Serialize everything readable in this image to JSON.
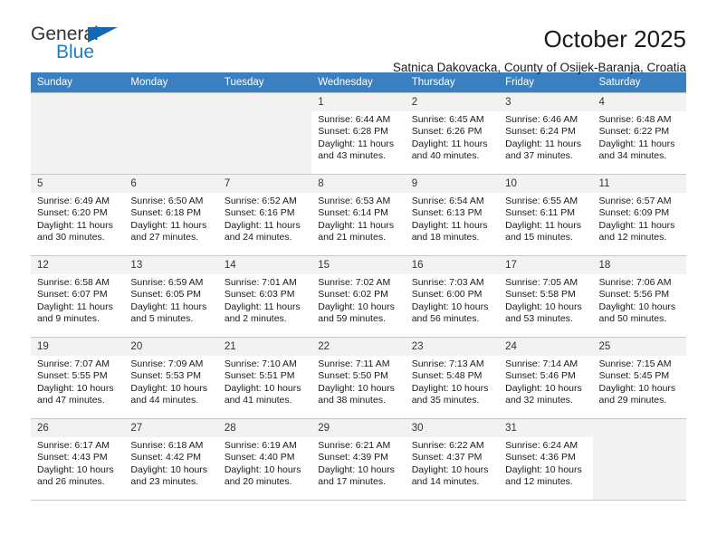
{
  "brand": {
    "line1": "General",
    "line2": "Blue",
    "flag_icon": "triangle-flag-icon",
    "color_primary": "#1268b3",
    "color_secondary": "#1f7fc4"
  },
  "header": {
    "month_title": "October 2025",
    "subtitle": "Satnica Dakovacka, County of Osijek-Baranja, Croatia"
  },
  "calendar": {
    "header_background": "#3a80c1",
    "weekday_headers": [
      "Sunday",
      "Monday",
      "Tuesday",
      "Wednesday",
      "Thursday",
      "Friday",
      "Saturday"
    ],
    "labels": {
      "sunrise": "Sunrise:",
      "sunset": "Sunset:",
      "daylight": "Daylight:"
    },
    "weeks": [
      [
        {
          "day": "",
          "empty": true
        },
        {
          "day": "",
          "empty": true
        },
        {
          "day": "",
          "empty": true
        },
        {
          "day": "1",
          "sunrise": "Sunrise: 6:44 AM",
          "sunset": "Sunset: 6:28 PM",
          "daylight_line1": "Daylight: 11 hours",
          "daylight_line2": "and 43 minutes."
        },
        {
          "day": "2",
          "sunrise": "Sunrise: 6:45 AM",
          "sunset": "Sunset: 6:26 PM",
          "daylight_line1": "Daylight: 11 hours",
          "daylight_line2": "and 40 minutes."
        },
        {
          "day": "3",
          "sunrise": "Sunrise: 6:46 AM",
          "sunset": "Sunset: 6:24 PM",
          "daylight_line1": "Daylight: 11 hours",
          "daylight_line2": "and 37 minutes."
        },
        {
          "day": "4",
          "sunrise": "Sunrise: 6:48 AM",
          "sunset": "Sunset: 6:22 PM",
          "daylight_line1": "Daylight: 11 hours",
          "daylight_line2": "and 34 minutes."
        }
      ],
      [
        {
          "day": "5",
          "sunrise": "Sunrise: 6:49 AM",
          "sunset": "Sunset: 6:20 PM",
          "daylight_line1": "Daylight: 11 hours",
          "daylight_line2": "and 30 minutes."
        },
        {
          "day": "6",
          "sunrise": "Sunrise: 6:50 AM",
          "sunset": "Sunset: 6:18 PM",
          "daylight_line1": "Daylight: 11 hours",
          "daylight_line2": "and 27 minutes."
        },
        {
          "day": "7",
          "sunrise": "Sunrise: 6:52 AM",
          "sunset": "Sunset: 6:16 PM",
          "daylight_line1": "Daylight: 11 hours",
          "daylight_line2": "and 24 minutes."
        },
        {
          "day": "8",
          "sunrise": "Sunrise: 6:53 AM",
          "sunset": "Sunset: 6:14 PM",
          "daylight_line1": "Daylight: 11 hours",
          "daylight_line2": "and 21 minutes."
        },
        {
          "day": "9",
          "sunrise": "Sunrise: 6:54 AM",
          "sunset": "Sunset: 6:13 PM",
          "daylight_line1": "Daylight: 11 hours",
          "daylight_line2": "and 18 minutes."
        },
        {
          "day": "10",
          "sunrise": "Sunrise: 6:55 AM",
          "sunset": "Sunset: 6:11 PM",
          "daylight_line1": "Daylight: 11 hours",
          "daylight_line2": "and 15 minutes."
        },
        {
          "day": "11",
          "sunrise": "Sunrise: 6:57 AM",
          "sunset": "Sunset: 6:09 PM",
          "daylight_line1": "Daylight: 11 hours",
          "daylight_line2": "and 12 minutes."
        }
      ],
      [
        {
          "day": "12",
          "sunrise": "Sunrise: 6:58 AM",
          "sunset": "Sunset: 6:07 PM",
          "daylight_line1": "Daylight: 11 hours",
          "daylight_line2": "and 9 minutes."
        },
        {
          "day": "13",
          "sunrise": "Sunrise: 6:59 AM",
          "sunset": "Sunset: 6:05 PM",
          "daylight_line1": "Daylight: 11 hours",
          "daylight_line2": "and 5 minutes."
        },
        {
          "day": "14",
          "sunrise": "Sunrise: 7:01 AM",
          "sunset": "Sunset: 6:03 PM",
          "daylight_line1": "Daylight: 11 hours",
          "daylight_line2": "and 2 minutes."
        },
        {
          "day": "15",
          "sunrise": "Sunrise: 7:02 AM",
          "sunset": "Sunset: 6:02 PM",
          "daylight_line1": "Daylight: 10 hours",
          "daylight_line2": "and 59 minutes."
        },
        {
          "day": "16",
          "sunrise": "Sunrise: 7:03 AM",
          "sunset": "Sunset: 6:00 PM",
          "daylight_line1": "Daylight: 10 hours",
          "daylight_line2": "and 56 minutes."
        },
        {
          "day": "17",
          "sunrise": "Sunrise: 7:05 AM",
          "sunset": "Sunset: 5:58 PM",
          "daylight_line1": "Daylight: 10 hours",
          "daylight_line2": "and 53 minutes."
        },
        {
          "day": "18",
          "sunrise": "Sunrise: 7:06 AM",
          "sunset": "Sunset: 5:56 PM",
          "daylight_line1": "Daylight: 10 hours",
          "daylight_line2": "and 50 minutes."
        }
      ],
      [
        {
          "day": "19",
          "sunrise": "Sunrise: 7:07 AM",
          "sunset": "Sunset: 5:55 PM",
          "daylight_line1": "Daylight: 10 hours",
          "daylight_line2": "and 47 minutes."
        },
        {
          "day": "20",
          "sunrise": "Sunrise: 7:09 AM",
          "sunset": "Sunset: 5:53 PM",
          "daylight_line1": "Daylight: 10 hours",
          "daylight_line2": "and 44 minutes."
        },
        {
          "day": "21",
          "sunrise": "Sunrise: 7:10 AM",
          "sunset": "Sunset: 5:51 PM",
          "daylight_line1": "Daylight: 10 hours",
          "daylight_line2": "and 41 minutes."
        },
        {
          "day": "22",
          "sunrise": "Sunrise: 7:11 AM",
          "sunset": "Sunset: 5:50 PM",
          "daylight_line1": "Daylight: 10 hours",
          "daylight_line2": "and 38 minutes."
        },
        {
          "day": "23",
          "sunrise": "Sunrise: 7:13 AM",
          "sunset": "Sunset: 5:48 PM",
          "daylight_line1": "Daylight: 10 hours",
          "daylight_line2": "and 35 minutes."
        },
        {
          "day": "24",
          "sunrise": "Sunrise: 7:14 AM",
          "sunset": "Sunset: 5:46 PM",
          "daylight_line1": "Daylight: 10 hours",
          "daylight_line2": "and 32 minutes."
        },
        {
          "day": "25",
          "sunrise": "Sunrise: 7:15 AM",
          "sunset": "Sunset: 5:45 PM",
          "daylight_line1": "Daylight: 10 hours",
          "daylight_line2": "and 29 minutes."
        }
      ],
      [
        {
          "day": "26",
          "sunrise": "Sunrise: 6:17 AM",
          "sunset": "Sunset: 4:43 PM",
          "daylight_line1": "Daylight: 10 hours",
          "daylight_line2": "and 26 minutes."
        },
        {
          "day": "27",
          "sunrise": "Sunrise: 6:18 AM",
          "sunset": "Sunset: 4:42 PM",
          "daylight_line1": "Daylight: 10 hours",
          "daylight_line2": "and 23 minutes."
        },
        {
          "day": "28",
          "sunrise": "Sunrise: 6:19 AM",
          "sunset": "Sunset: 4:40 PM",
          "daylight_line1": "Daylight: 10 hours",
          "daylight_line2": "and 20 minutes."
        },
        {
          "day": "29",
          "sunrise": "Sunrise: 6:21 AM",
          "sunset": "Sunset: 4:39 PM",
          "daylight_line1": "Daylight: 10 hours",
          "daylight_line2": "and 17 minutes."
        },
        {
          "day": "30",
          "sunrise": "Sunrise: 6:22 AM",
          "sunset": "Sunset: 4:37 PM",
          "daylight_line1": "Daylight: 10 hours",
          "daylight_line2": "and 14 minutes."
        },
        {
          "day": "31",
          "sunrise": "Sunrise: 6:24 AM",
          "sunset": "Sunset: 4:36 PM",
          "daylight_line1": "Daylight: 10 hours",
          "daylight_line2": "and 12 minutes."
        },
        {
          "day": "",
          "empty": true
        }
      ]
    ]
  }
}
